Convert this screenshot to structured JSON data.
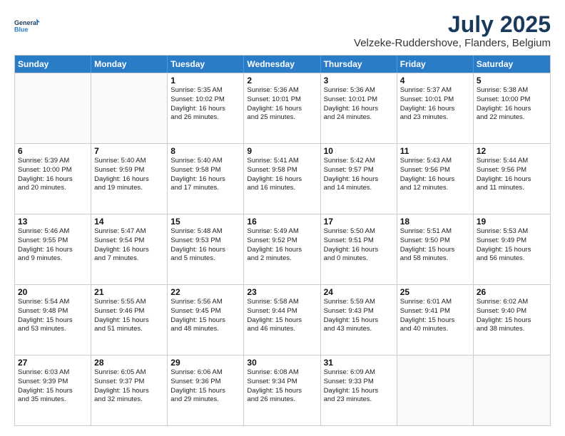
{
  "logo": {
    "line1": "General",
    "line2": "Blue"
  },
  "title": "July 2025",
  "subtitle": "Velzeke-Ruddershove, Flanders, Belgium",
  "days": [
    "Sunday",
    "Monday",
    "Tuesday",
    "Wednesday",
    "Thursday",
    "Friday",
    "Saturday"
  ],
  "weeks": [
    [
      {
        "day": "",
        "text": ""
      },
      {
        "day": "",
        "text": ""
      },
      {
        "day": "1",
        "text": "Sunrise: 5:35 AM\nSunset: 10:02 PM\nDaylight: 16 hours\nand 26 minutes."
      },
      {
        "day": "2",
        "text": "Sunrise: 5:36 AM\nSunset: 10:01 PM\nDaylight: 16 hours\nand 25 minutes."
      },
      {
        "day": "3",
        "text": "Sunrise: 5:36 AM\nSunset: 10:01 PM\nDaylight: 16 hours\nand 24 minutes."
      },
      {
        "day": "4",
        "text": "Sunrise: 5:37 AM\nSunset: 10:01 PM\nDaylight: 16 hours\nand 23 minutes."
      },
      {
        "day": "5",
        "text": "Sunrise: 5:38 AM\nSunset: 10:00 PM\nDaylight: 16 hours\nand 22 minutes."
      }
    ],
    [
      {
        "day": "6",
        "text": "Sunrise: 5:39 AM\nSunset: 10:00 PM\nDaylight: 16 hours\nand 20 minutes."
      },
      {
        "day": "7",
        "text": "Sunrise: 5:40 AM\nSunset: 9:59 PM\nDaylight: 16 hours\nand 19 minutes."
      },
      {
        "day": "8",
        "text": "Sunrise: 5:40 AM\nSunset: 9:58 PM\nDaylight: 16 hours\nand 17 minutes."
      },
      {
        "day": "9",
        "text": "Sunrise: 5:41 AM\nSunset: 9:58 PM\nDaylight: 16 hours\nand 16 minutes."
      },
      {
        "day": "10",
        "text": "Sunrise: 5:42 AM\nSunset: 9:57 PM\nDaylight: 16 hours\nand 14 minutes."
      },
      {
        "day": "11",
        "text": "Sunrise: 5:43 AM\nSunset: 9:56 PM\nDaylight: 16 hours\nand 12 minutes."
      },
      {
        "day": "12",
        "text": "Sunrise: 5:44 AM\nSunset: 9:56 PM\nDaylight: 16 hours\nand 11 minutes."
      }
    ],
    [
      {
        "day": "13",
        "text": "Sunrise: 5:46 AM\nSunset: 9:55 PM\nDaylight: 16 hours\nand 9 minutes."
      },
      {
        "day": "14",
        "text": "Sunrise: 5:47 AM\nSunset: 9:54 PM\nDaylight: 16 hours\nand 7 minutes."
      },
      {
        "day": "15",
        "text": "Sunrise: 5:48 AM\nSunset: 9:53 PM\nDaylight: 16 hours\nand 5 minutes."
      },
      {
        "day": "16",
        "text": "Sunrise: 5:49 AM\nSunset: 9:52 PM\nDaylight: 16 hours\nand 2 minutes."
      },
      {
        "day": "17",
        "text": "Sunrise: 5:50 AM\nSunset: 9:51 PM\nDaylight: 16 hours\nand 0 minutes."
      },
      {
        "day": "18",
        "text": "Sunrise: 5:51 AM\nSunset: 9:50 PM\nDaylight: 15 hours\nand 58 minutes."
      },
      {
        "day": "19",
        "text": "Sunrise: 5:53 AM\nSunset: 9:49 PM\nDaylight: 15 hours\nand 56 minutes."
      }
    ],
    [
      {
        "day": "20",
        "text": "Sunrise: 5:54 AM\nSunset: 9:48 PM\nDaylight: 15 hours\nand 53 minutes."
      },
      {
        "day": "21",
        "text": "Sunrise: 5:55 AM\nSunset: 9:46 PM\nDaylight: 15 hours\nand 51 minutes."
      },
      {
        "day": "22",
        "text": "Sunrise: 5:56 AM\nSunset: 9:45 PM\nDaylight: 15 hours\nand 48 minutes."
      },
      {
        "day": "23",
        "text": "Sunrise: 5:58 AM\nSunset: 9:44 PM\nDaylight: 15 hours\nand 46 minutes."
      },
      {
        "day": "24",
        "text": "Sunrise: 5:59 AM\nSunset: 9:43 PM\nDaylight: 15 hours\nand 43 minutes."
      },
      {
        "day": "25",
        "text": "Sunrise: 6:01 AM\nSunset: 9:41 PM\nDaylight: 15 hours\nand 40 minutes."
      },
      {
        "day": "26",
        "text": "Sunrise: 6:02 AM\nSunset: 9:40 PM\nDaylight: 15 hours\nand 38 minutes."
      }
    ],
    [
      {
        "day": "27",
        "text": "Sunrise: 6:03 AM\nSunset: 9:39 PM\nDaylight: 15 hours\nand 35 minutes."
      },
      {
        "day": "28",
        "text": "Sunrise: 6:05 AM\nSunset: 9:37 PM\nDaylight: 15 hours\nand 32 minutes."
      },
      {
        "day": "29",
        "text": "Sunrise: 6:06 AM\nSunset: 9:36 PM\nDaylight: 15 hours\nand 29 minutes."
      },
      {
        "day": "30",
        "text": "Sunrise: 6:08 AM\nSunset: 9:34 PM\nDaylight: 15 hours\nand 26 minutes."
      },
      {
        "day": "31",
        "text": "Sunrise: 6:09 AM\nSunset: 9:33 PM\nDaylight: 15 hours\nand 23 minutes."
      },
      {
        "day": "",
        "text": ""
      },
      {
        "day": "",
        "text": ""
      }
    ]
  ]
}
